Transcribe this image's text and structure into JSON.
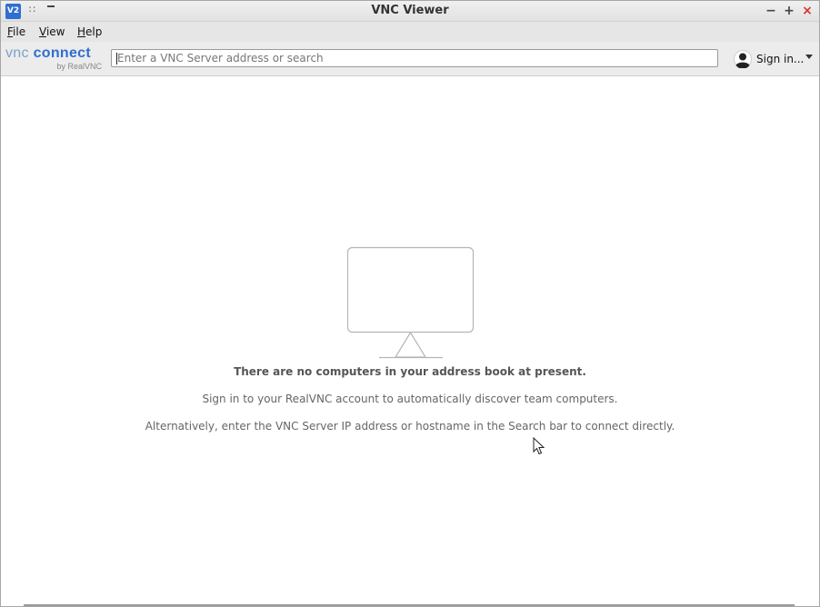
{
  "window": {
    "title": "VNC Viewer",
    "app_icon_text": "V2",
    "controls": {
      "minimize": "−",
      "maximize": "+",
      "close": "×"
    }
  },
  "menu": {
    "items": [
      {
        "label": "File",
        "mnemonic": "F",
        "rest": "ile"
      },
      {
        "label": "View",
        "mnemonic": "V",
        "rest": "iew"
      },
      {
        "label": "Help",
        "mnemonic": "H",
        "rest": "elp"
      }
    ]
  },
  "toolbar": {
    "logo_vnc": "vnc",
    "logo_connect": "connect",
    "logo_sub": "by RealVNC",
    "search": {
      "placeholder": "Enter a VNC Server address or search",
      "value": ""
    },
    "signin_label": "Sign in..."
  },
  "empty_state": {
    "title": "There are no computers in your address book at present.",
    "line1": "Sign in to your RealVNC account to automatically discover team computers.",
    "line2": "Alternatively, enter the VNC Server IP address or hostname in the Search bar to connect directly."
  },
  "icons": {
    "app": "vnc-app-icon",
    "monitor": "monitor-icon",
    "user": "user-avatar-icon",
    "dropdown": "chevron-down-icon",
    "cursor": "mouse-pointer-icon"
  },
  "colors": {
    "accent": "#2f6fd0",
    "close": "#d9322d",
    "toolbar_bg": "#ececec",
    "monitor_stroke": "#b5b5b5"
  }
}
